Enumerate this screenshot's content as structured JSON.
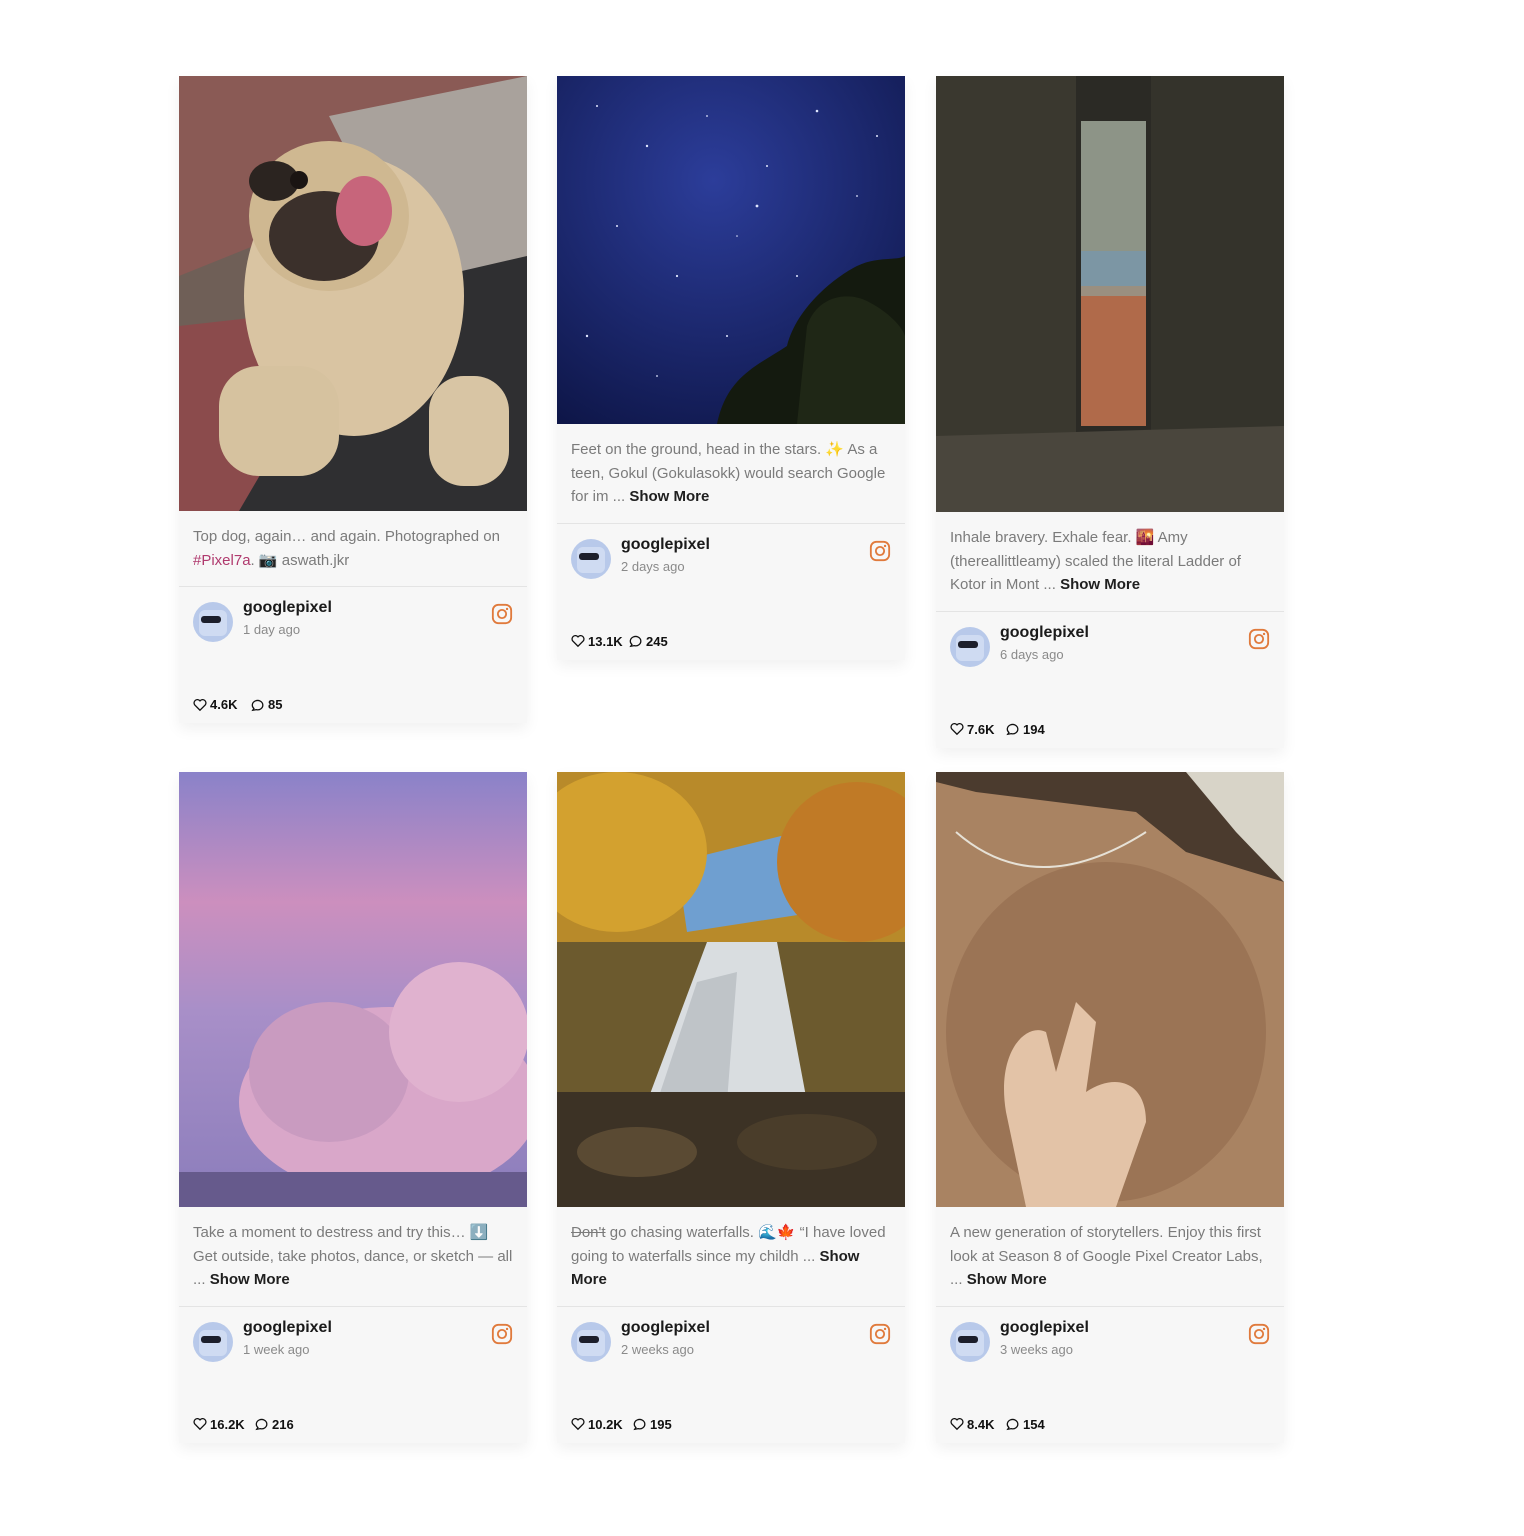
{
  "accent": {
    "hashtag": "#b03a6e",
    "instagram": "#e07a3c"
  },
  "posts": [
    {
      "caption_parts": [
        "Top dog, again… and again. Photographed on ",
        "#Pixel7a",
        ". 📷 aswath.jkr"
      ],
      "author": "googlepixel",
      "time": "1 day ago",
      "likes": "4.6K",
      "comments": "85",
      "photo_icon": "pug-photo"
    },
    {
      "caption": "Feet on the ground, head in the stars. ✨ As a teen, Gokul (Gokulasokk) would search Google for im ...",
      "show_more": "Show More",
      "author": "googlepixel",
      "time": "2 days ago",
      "likes": "13.1K",
      "comments": "245",
      "photo_icon": "night-sky-photo"
    },
    {
      "caption": "Inhale bravery. Exhale fear. 🌇 Amy (thereallittleamy) scaled the literal Ladder of Kotor in Mont ...",
      "show_more": "Show More",
      "author": "googlepixel",
      "time": "6 days ago",
      "likes": "7.6K",
      "comments": "194",
      "photo_icon": "stone-window-photo"
    },
    {
      "caption": "Take a moment to destress and try this… ⬇️ Get outside, take photos, dance, or sketch — all ...",
      "show_more": "Show More",
      "author": "googlepixel",
      "time": "1 week ago",
      "likes": "16.2K",
      "comments": "216",
      "photo_icon": "clouds-photo"
    },
    {
      "caption_strike": "Don't",
      "caption": " go chasing waterfalls. 🌊🍁 “I have loved going to waterfalls since my childh ...",
      "show_more": "Show More",
      "author": "googlepixel",
      "time": "2 weeks ago",
      "likes": "10.2K",
      "comments": "195",
      "photo_icon": "waterfall-photo"
    },
    {
      "caption": "A new generation of storytellers. Enjoy this first look at Season 8 of Google Pixel Creator Labs, ...",
      "show_more": "Show More",
      "author": "googlepixel",
      "time": "3 weeks ago",
      "likes": "8.4K",
      "comments": "154",
      "photo_icon": "hand-photo"
    }
  ]
}
